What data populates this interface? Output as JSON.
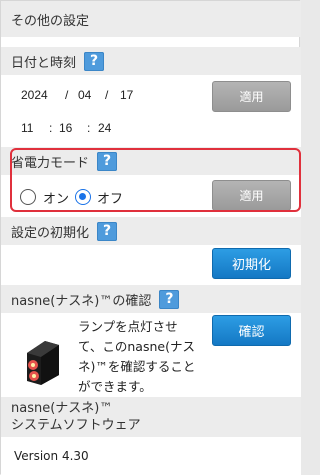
{
  "title": "その他の設定",
  "datetime": {
    "label": "日付と時刻",
    "year": "2024",
    "month": "04",
    "day": "17",
    "hour": "11",
    "minute": "16",
    "second": "24",
    "date_sep": "/",
    "time_sep": ":",
    "apply": "適用"
  },
  "power": {
    "label": "省電力モード",
    "on": "オン",
    "off": "オフ",
    "selected": "off",
    "apply": "適用"
  },
  "reset": {
    "label": "設定の初期化",
    "button": "初期化"
  },
  "confirm": {
    "label": "nasne(ナスネ)™の確認",
    "description": "ランプを点灯させ\nて、このnasne(ナス\nネ)™を確認すること\nができます。",
    "button": "確認"
  },
  "software": {
    "label_line1": "nasne(ナスネ)™",
    "label_line2": "システムソフトウェア",
    "version": "Version 4.30"
  },
  "help_glyph": "?",
  "colors": {
    "accent_blue": "#1a84d4",
    "help_blue": "#4f9bdc",
    "highlight_red": "#e0303c",
    "apply_gray": "#a6a6a6"
  }
}
